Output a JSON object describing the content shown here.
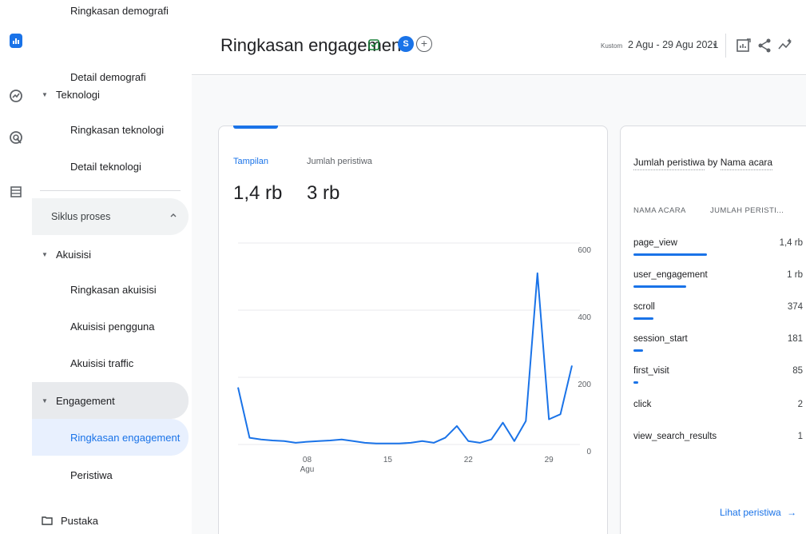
{
  "nav": {
    "items": [
      {
        "label": "Ringkasan demografi",
        "kind": "sub"
      },
      {
        "label": "Detail demografi",
        "kind": "sub"
      },
      {
        "label": "Teknologi",
        "kind": "group"
      },
      {
        "label": "Ringkasan teknologi",
        "kind": "sub"
      },
      {
        "label": "Detail teknologi",
        "kind": "sub"
      }
    ],
    "section_label": "Siklus proses",
    "section_items": [
      {
        "label": "Akuisisi",
        "kind": "group"
      },
      {
        "label": "Ringkasan akuisisi",
        "kind": "sub"
      },
      {
        "label": "Akuisisi pengguna",
        "kind": "sub"
      },
      {
        "label": "Akuisisi traffic",
        "kind": "sub"
      },
      {
        "label": "Engagement",
        "kind": "group"
      },
      {
        "label": "Ringkasan engagement",
        "kind": "sub"
      },
      {
        "label": "Peristiwa",
        "kind": "sub"
      }
    ],
    "library_label": "Pustaka"
  },
  "header": {
    "title": "Ringkasan engagement",
    "avatar_letter": "S",
    "add_label": "+",
    "date_label": "Kustom",
    "date_range": "2 Agu - 29 Agu 2021"
  },
  "metrics": {
    "tab1_label": "Tampilan",
    "tab1_value": "1,4 rb",
    "tab2_label": "Jumlah peristiwa",
    "tab2_value": "3 rb"
  },
  "chart_data": {
    "type": "line",
    "x": [
      "2 Agu",
      "3 Agu",
      "4 Agu",
      "5 Agu",
      "6 Agu",
      "7 Agu",
      "8 Agu",
      "9 Agu",
      "10 Agu",
      "11 Agu",
      "12 Agu",
      "13 Agu",
      "14 Agu",
      "15 Agu",
      "16 Agu",
      "17 Agu",
      "18 Agu",
      "19 Agu",
      "20 Agu",
      "21 Agu",
      "22 Agu",
      "23 Agu",
      "24 Agu",
      "25 Agu",
      "26 Agu",
      "27 Agu",
      "28 Agu",
      "29 Agu"
    ],
    "series": [
      {
        "values": [
          170,
          20,
          15,
          12,
          10,
          5,
          8,
          10,
          12,
          15,
          10,
          5,
          3,
          3,
          3,
          5,
          10,
          5,
          20,
          55,
          10,
          5,
          15,
          65,
          10,
          70,
          510,
          75,
          90,
          235
        ]
      }
    ],
    "xticks": [
      {
        "x": "8 Agu",
        "label": "08",
        "sublabel": "Agu"
      },
      {
        "x": "15 Agu",
        "label": "15",
        "sublabel": ""
      },
      {
        "x": "22 Agu",
        "label": "22",
        "sublabel": ""
      },
      {
        "x": "29 Agu",
        "label": "29",
        "sublabel": ""
      }
    ],
    "yticks": [
      0,
      200,
      400,
      600
    ],
    "ylim": [
      0,
      600
    ],
    "grid": true,
    "line_color": "#1a73e8"
  },
  "events_table": {
    "title_part1": "Jumlah peristiwa",
    "title_mid": " by ",
    "title_part2": "Nama acara",
    "col1": "NAMA ACARA",
    "col2": "JUMLAH PERISTI...",
    "rows": [
      {
        "name": "page_view",
        "value": "1,4 rb",
        "fraction": 1.0
      },
      {
        "name": "user_engagement",
        "value": "1 rb",
        "fraction": 0.72
      },
      {
        "name": "scroll",
        "value": "374",
        "fraction": 0.27
      },
      {
        "name": "session_start",
        "value": "181",
        "fraction": 0.13
      },
      {
        "name": "first_visit",
        "value": "85",
        "fraction": 0.06
      },
      {
        "name": "click",
        "value": "2",
        "fraction": 0.0
      },
      {
        "name": "view_search_results",
        "value": "1",
        "fraction": 0.0
      }
    ],
    "link_label": "Lihat peristiwa",
    "link_arrow": "→"
  }
}
